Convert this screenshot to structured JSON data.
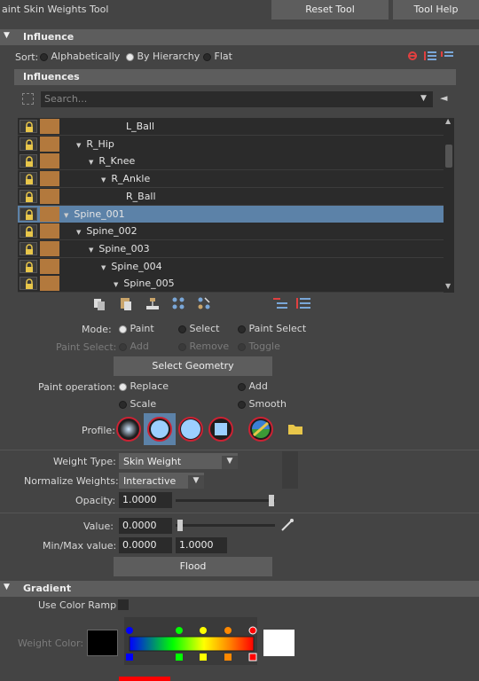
{
  "title": "aint Skin Weights Tool",
  "top_buttons": {
    "reset": "Reset Tool",
    "help": "Tool Help"
  },
  "influence_section": {
    "header": "Influence",
    "sort_label": "Sort:",
    "sort_options": [
      "Alphabetically",
      "By Hierarchy",
      "Flat"
    ],
    "sort_selected": "By Hierarchy",
    "influences_header": "Influences",
    "search_placeholder": "Search...",
    "tree": [
      {
        "label": "L_Ball",
        "depth": 4,
        "expanded": false,
        "selected": false
      },
      {
        "label": "R_Hip",
        "depth": 1,
        "expanded": true,
        "selected": false
      },
      {
        "label": "R_Knee",
        "depth": 2,
        "expanded": true,
        "selected": false
      },
      {
        "label": "R_Ankle",
        "depth": 3,
        "expanded": true,
        "selected": false
      },
      {
        "label": "R_Ball",
        "depth": 4,
        "expanded": false,
        "selected": false
      },
      {
        "label": "Spine_001",
        "depth": 0,
        "expanded": true,
        "selected": true
      },
      {
        "label": "Spine_002",
        "depth": 1,
        "expanded": true,
        "selected": false
      },
      {
        "label": "Spine_003",
        "depth": 2,
        "expanded": true,
        "selected": false
      },
      {
        "label": "Spine_004",
        "depth": 3,
        "expanded": true,
        "selected": false
      },
      {
        "label": "Spine_005",
        "depth": 4,
        "expanded": true,
        "selected": false
      }
    ],
    "joint_color": "#b3793d",
    "selection_color": "#5c82a8"
  },
  "mode": {
    "label": "Mode:",
    "options": [
      "Paint",
      "Select",
      "Paint Select"
    ],
    "selected": "Paint",
    "paint_select_label": "Paint Select:",
    "paint_select_options": [
      "Add",
      "Remove",
      "Toggle"
    ]
  },
  "select_geometry": "Select Geometry",
  "paint_operation": {
    "label": "Paint operation:",
    "options": [
      "Replace",
      "Add",
      "Scale",
      "Smooth"
    ],
    "selected": "Replace"
  },
  "profile": {
    "label": "Profile:",
    "brushes": [
      "soft-brush-icon",
      "solid-round-brush-icon",
      "round-brush-icon",
      "square-brush-icon",
      "custom-brush-icon",
      "folder-icon"
    ],
    "selected": 1
  },
  "weight_type": {
    "label": "Weight Type:",
    "value": "Skin Weight"
  },
  "normalize": {
    "label": "Normalize Weights:",
    "value": "Interactive"
  },
  "opacity": {
    "label": "Opacity:",
    "value": "1.0000",
    "level": 1.0
  },
  "value": {
    "label": "Value:",
    "value": "0.0000",
    "level": 0.0
  },
  "minmax": {
    "label": "Min/Max value:",
    "min": "0.0000",
    "max": "1.0000"
  },
  "flood": "Flood",
  "gradient": {
    "header": "Gradient",
    "use_color_ramp": "Use Color Ramp",
    "weight_color": "Weight Color:",
    "ramp_colors": [
      "#0000ff",
      "#00ff00",
      "#ffff00",
      "#ff8800",
      "#ff0000"
    ]
  }
}
